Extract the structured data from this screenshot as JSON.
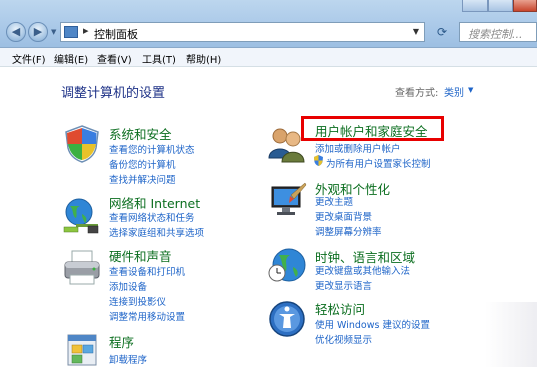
{
  "window": {
    "address_text": "控制面板",
    "search_placeholder": "搜索控制..."
  },
  "menubar": [
    {
      "label": "文件(F)"
    },
    {
      "label": "编辑(E)"
    },
    {
      "label": "查看(V)"
    },
    {
      "label": "工具(T)"
    },
    {
      "label": "帮助(H)"
    }
  ],
  "main": {
    "title": "调整计算机的设置",
    "view_by_label": "查看方式:",
    "view_by_value": "类别"
  },
  "categories": [
    {
      "title": "系统和安全",
      "icon": "shield-icon",
      "links": [
        "查看您的计算机状态",
        "备份您的计算机",
        "查找并解决问题"
      ]
    },
    {
      "title": "网络和 Internet",
      "icon": "network-globe-icon",
      "links": [
        "查看网络状态和任务",
        "选择家庭组和共享选项"
      ]
    },
    {
      "title": "硬件和声音",
      "icon": "printer-icon",
      "links": [
        "查看设备和打印机",
        "添加设备",
        "连接到投影仪",
        "调整常用移动设置"
      ]
    },
    {
      "title": "程序",
      "icon": "programs-icon",
      "links": [
        "卸载程序"
      ]
    },
    {
      "title": "用户帐户和家庭安全",
      "icon": "users-icon",
      "links": [
        "添加或删除用户帐户",
        "为所有用户设置家长控制"
      ]
    },
    {
      "title": "外观和个性化",
      "icon": "display-icon",
      "links": [
        "更改主题",
        "更改桌面背景",
        "调整屏幕分辨率"
      ]
    },
    {
      "title": "时钟、语言和区域",
      "icon": "clock-globe-icon",
      "links": [
        "更改键盘或其他输入法",
        "更改显示语言"
      ]
    },
    {
      "title": "轻松访问",
      "icon": "ease-of-access-icon",
      "links": [
        "使用 Windows 建议的设置",
        "优化视频显示"
      ]
    }
  ],
  "colors": {
    "title_green": "#0b6e1f",
    "link_blue": "#1e64c8",
    "heading_blue": "#1e3287",
    "highlight_red": "#e80000"
  }
}
